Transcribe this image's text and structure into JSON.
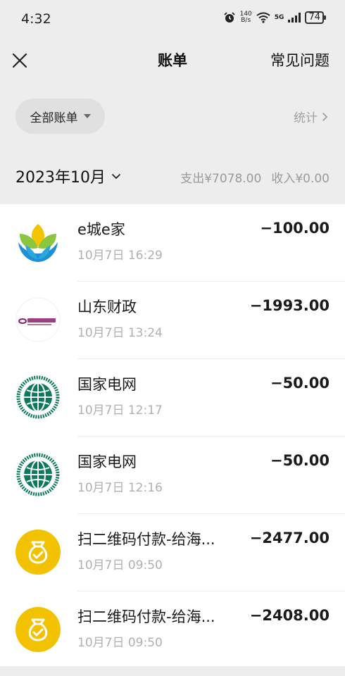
{
  "status": {
    "time": "4:32",
    "net_speed_value": "140",
    "net_speed_unit": "B/s",
    "network": "5G",
    "battery": "74"
  },
  "nav": {
    "title": "账单",
    "faq": "常见问题"
  },
  "filter": {
    "all_bills": "全部账单",
    "stats": "统计"
  },
  "month": {
    "label": "2023年10月",
    "expense": "支出¥7078.00",
    "income": "收入¥0.00"
  },
  "transactions": [
    {
      "name": "e城e家",
      "time": "10月7日 16:29",
      "amount": "−100.00",
      "icon": "e-city-e-home-logo"
    },
    {
      "name": "山东财政",
      "time": "10月7日 13:24",
      "amount": "−1993.00",
      "icon": "everbright-cloud-pay-logo"
    },
    {
      "name": "国家电网",
      "time": "10月7日 12:17",
      "amount": "−50.00",
      "icon": "state-grid-logo"
    },
    {
      "name": "国家电网",
      "time": "10月7日 12:16",
      "amount": "−50.00",
      "icon": "state-grid-logo"
    },
    {
      "name": "扫二维码付款-给海...",
      "time": "10月7日 09:50",
      "amount": "−2477.00",
      "icon": "money-bag-icon"
    },
    {
      "name": "扫二维码付款-给海...",
      "time": "10月7日 09:50",
      "amount": "−2408.00",
      "icon": "money-bag-icon"
    }
  ],
  "colors": {
    "background": "#ededed",
    "money_bag": "#f2c200"
  }
}
